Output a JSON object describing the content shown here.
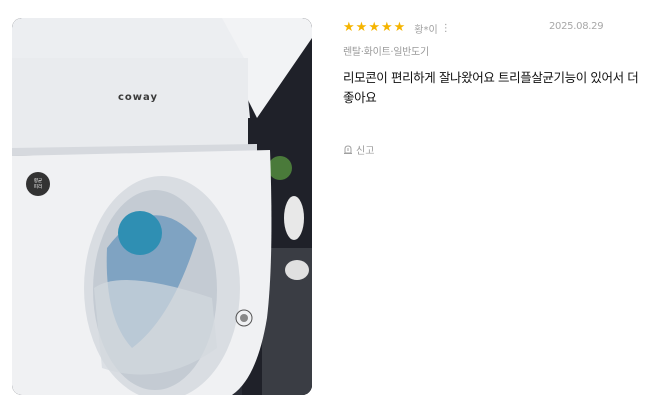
{
  "review": {
    "rating": 5,
    "stars": [
      "★",
      "★",
      "★",
      "★",
      "★"
    ],
    "reviewer": "황*이",
    "more_icon": "⋮",
    "date": "2025.08.29",
    "option": "렌탈·화이트·일반도기",
    "text": "리모콘이 편리하게 잘나왔어요 트리플살균기능이 있어서 더좋아요",
    "report_label": "신고",
    "report_icon": "siren-icon"
  },
  "photo": {
    "brand_text": "coway",
    "badge_text": "향균\n피리",
    "icon": "toilet-photo"
  },
  "colors": {
    "star": "#f5b400",
    "meta": "#a0a0a0",
    "text": "#111111"
  }
}
